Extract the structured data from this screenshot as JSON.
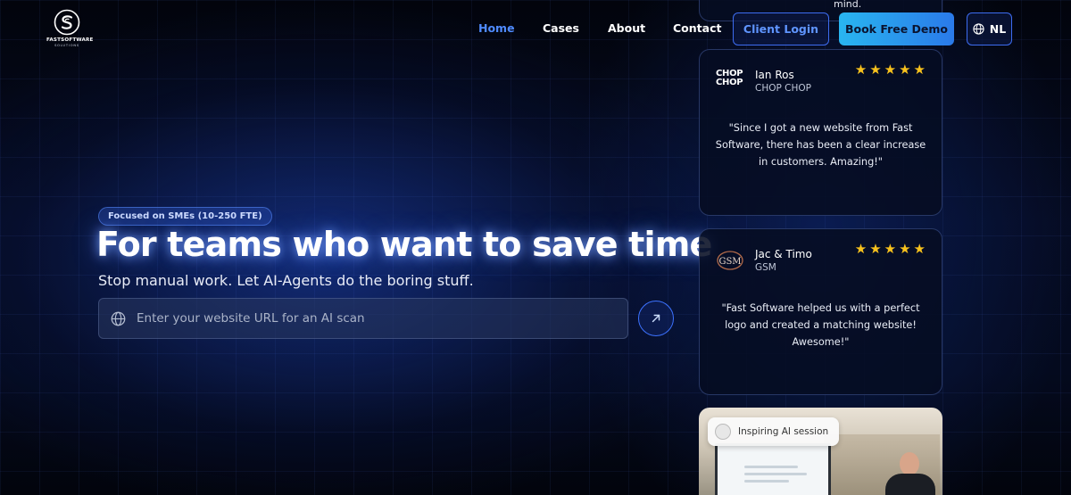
{
  "brand": {
    "name": "FASTSOFTWARE",
    "tagline": "SOLUTIONS"
  },
  "nav": {
    "items": [
      {
        "label": "Home",
        "active": true
      },
      {
        "label": "Cases"
      },
      {
        "label": "About"
      },
      {
        "label": "Contact"
      }
    ],
    "login_label": "Client Login",
    "demo_label": "Book Free Demo",
    "lang_label": "NL"
  },
  "hero": {
    "badge": "Focused on SMEs (10-250 FTE)",
    "title": "For teams who want to save time",
    "subtitle": "Stop manual work. Let AI-Agents do the boring stuff.",
    "search_placeholder": "Enter your website URL for an AI scan"
  },
  "testimonials": {
    "top_partial_text": "mind.",
    "items": [
      {
        "logo_text": "CHOP CHOP",
        "name": "Ian Ros",
        "company": "CHOP CHOP",
        "rating": 5,
        "quote": "\"Since I got a new website from Fast Software, there has been a clear increase in customers. Amazing!\""
      },
      {
        "logo_text": "GSM",
        "name": "Jac & Timo",
        "company": "GSM",
        "rating": 5,
        "quote": "\"Fast Software helped us with a perfect logo and created a matching website! Awesome!\""
      }
    ]
  },
  "video": {
    "label": "Inspiring AI session"
  },
  "colors": {
    "accent": "#4f8bff",
    "star": "#f8c21d",
    "demo_from": "#29b5f0",
    "demo_to": "#2a7ae9"
  }
}
